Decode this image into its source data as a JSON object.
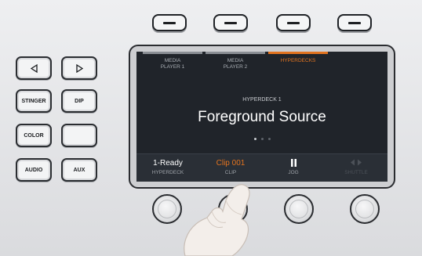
{
  "tabs": [
    {
      "line1": "MEDIA",
      "line2": "PLAYER 1"
    },
    {
      "line1": "MEDIA",
      "line2": "PLAYER 2"
    },
    {
      "line1": "HYPERDECKS",
      "line2": ""
    }
  ],
  "screen": {
    "subheading": "HYPERDECK 1",
    "title": "Foreground Source"
  },
  "functions": [
    {
      "value": "1-Ready",
      "label": "HYPERDECK"
    },
    {
      "value": "Clip 001",
      "label": "CLIP"
    },
    {
      "value": "",
      "label": "JOG"
    },
    {
      "value": "",
      "label": "SHUTTLE"
    }
  ],
  "buttons": {
    "stinger": "STINGER",
    "dip": "DIP",
    "color": "COLOR",
    "blank": "",
    "audio": "AUDIO",
    "aux": "AUX"
  },
  "colors": {
    "accent": "#e2731f",
    "lcd_bg": "#20242a"
  },
  "icons": [
    "arrow-left-icon",
    "arrow-right-icon",
    "pause-icon",
    "shuttle-icon"
  ]
}
